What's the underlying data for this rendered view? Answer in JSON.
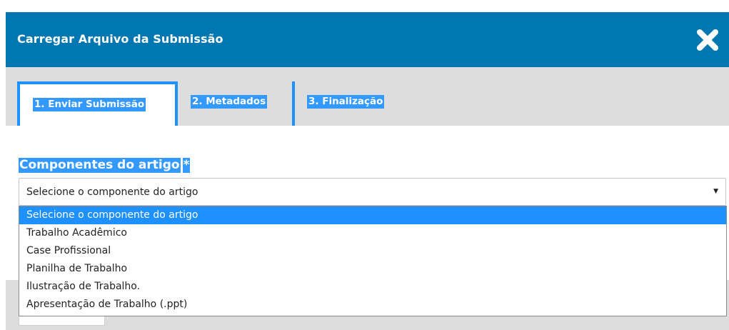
{
  "modal": {
    "title": "Carregar Arquivo da Submissão",
    "close_icon": "close-icon"
  },
  "tabs": [
    {
      "label": "1. Enviar Submissão",
      "active": true
    },
    {
      "label": "2. Metadados",
      "active": false
    },
    {
      "label": "3. Finalização",
      "active": false
    }
  ],
  "field": {
    "label": "Componentes do artigo",
    "required_marker": "*",
    "selected_value": "Selecione o componente do artigo",
    "arrow": "▼"
  },
  "dropdown": {
    "options": [
      "Selecione o componente do artigo",
      "Trabalho Acadêmico",
      "Case Profissional",
      "Planilha de Trabalho",
      "Ilustração de Trabalho.",
      "Apresentação de Trabalho (.ppt)"
    ],
    "highlighted_index": 0
  },
  "colors": {
    "header": "#0077b1",
    "accent": "#1e90ff",
    "selection": "#3399ff",
    "tabbar": "#dddddd"
  }
}
